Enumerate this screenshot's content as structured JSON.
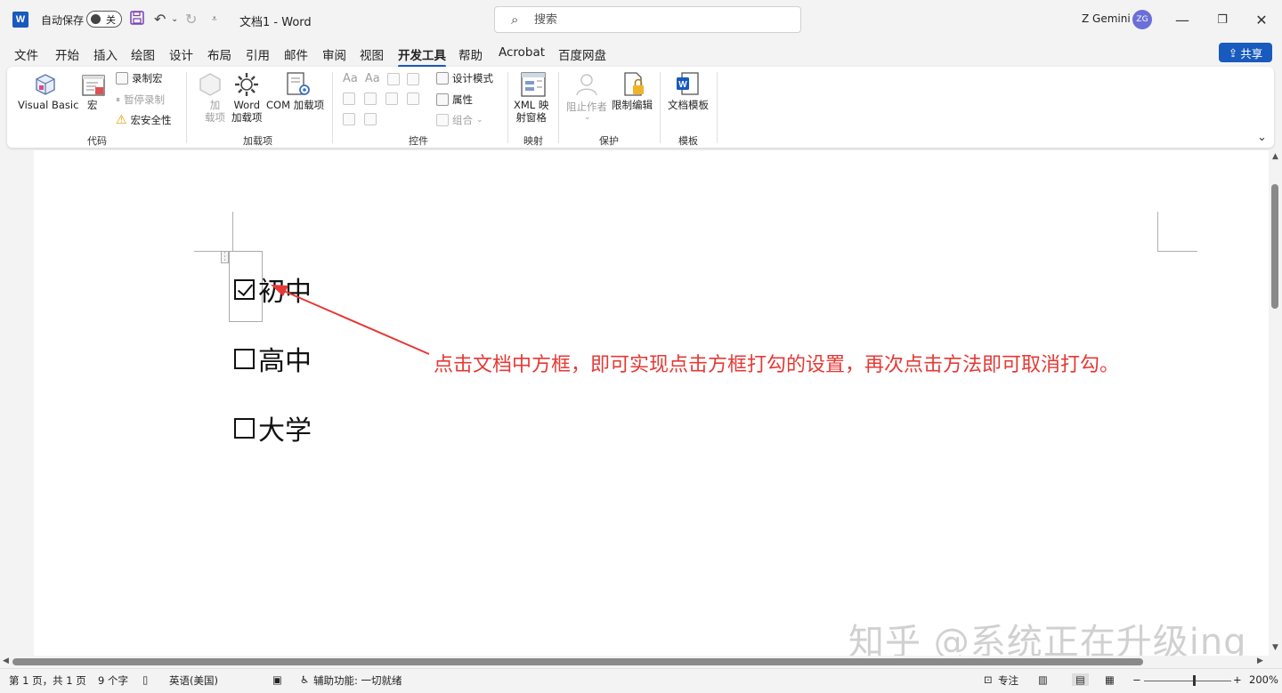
{
  "titlebar": {
    "logo_text": "W",
    "autosave_label": "自动保存",
    "autosave_state": "关",
    "doc_title": "文档1  -  Word",
    "search_placeholder": "搜索",
    "username": "Z Gemini",
    "avatar_initials": "ZG",
    "minimize": "—",
    "restore": "❐",
    "close": "✕"
  },
  "menu": {
    "tabs": [
      "文件",
      "开始",
      "插入",
      "绘图",
      "设计",
      "布局",
      "引用",
      "邮件",
      "审阅",
      "视图",
      "开发工具",
      "帮助",
      "Acrobat",
      "百度网盘"
    ],
    "active": "开发工具",
    "share_label": "共享"
  },
  "ribbon": {
    "code": {
      "visual_basic": "Visual Basic",
      "macros": "宏",
      "record_macro": "录制宏",
      "pause_recording": "暂停录制",
      "macro_security": "宏安全性",
      "label": "代码"
    },
    "addins": {
      "addins_line1": "加",
      "addins_line2": "载项",
      "word_addins_line1": "Word",
      "word_addins_line2": "加载项",
      "com_addins": "COM 加载项",
      "label": "加载项"
    },
    "controls": {
      "design_mode": "设计模式",
      "properties": "属性",
      "group": "组合",
      "label": "控件"
    },
    "mapping": {
      "xml_line1": "XML 映",
      "xml_line2": "射窗格",
      "label": "映射"
    },
    "protect": {
      "block_authors": "阻止作者",
      "restrict_editing": "限制编辑",
      "label": "保护"
    },
    "templates": {
      "document_template": "文档模板",
      "label": "模板"
    }
  },
  "document": {
    "items": [
      {
        "label": "初中",
        "checked": true
      },
      {
        "label": "高中",
        "checked": false
      },
      {
        "label": "大学",
        "checked": false
      }
    ],
    "annotation": "点击文档中方框，即可实现点击方框打勾的设置，再次点击方法即可取消打勾。",
    "annotation_color": "#e53935",
    "watermark": "知乎 @系统正在升级ing"
  },
  "statusbar": {
    "page": "第 1 页，共 1 页",
    "words": "9 个字",
    "language": "英语(美国)",
    "accessibility": "辅助功能: 一切就绪",
    "focus": "专注",
    "zoom": "200%"
  },
  "colors": {
    "accent": "#185abd"
  }
}
